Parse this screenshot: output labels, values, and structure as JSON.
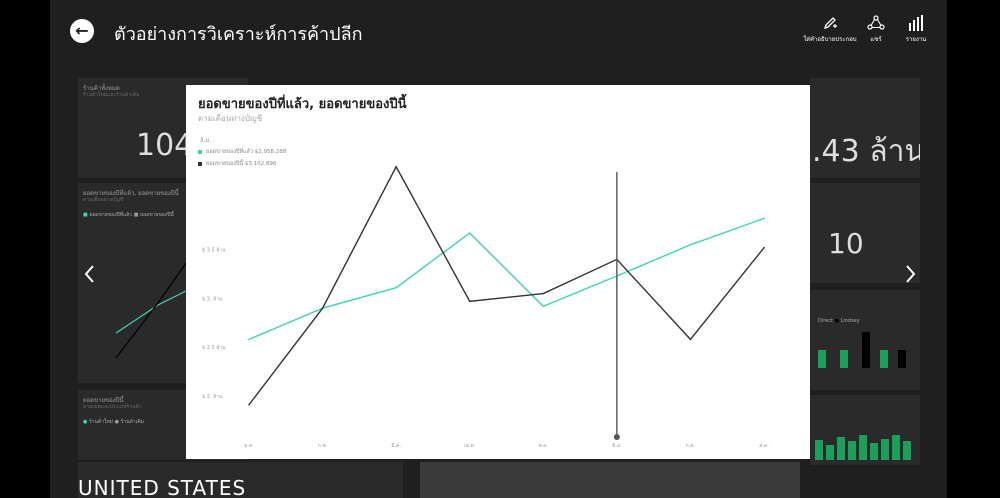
{
  "header": {
    "title": "ตัวอย่างการวิเคราะห์การค้าปลีก",
    "tools": [
      {
        "label": "ใส่คำอธิบายประกอบ",
        "icon": "annotate-pen-icon"
      },
      {
        "label": "แชร์",
        "icon": "share-icon"
      },
      {
        "label": "รายงาน",
        "icon": "report-bars-icon"
      }
    ]
  },
  "background": {
    "tile1_title": "ร้านค้าทั้งหมด",
    "tile1_sub": "ร้านค้าใหม่และร้านค้าเดิม",
    "tile1_value": "104",
    "tile2_title": "ยอดขายของปีที่แล้ว, ยอดขายของปีนี้",
    "tile2_sub": "ตามเดือนทางบัญชี",
    "tile2_legend": [
      "ยอดขายของปีที่แล้ว",
      "ยอดขายของปีนี้"
    ],
    "tile3_title": "ยอดขายของปีนี้",
    "tile3_sub": "ตามเขตและประเภทร้านค้า",
    "tile3_legend": [
      "ร้านค้าใหม่",
      "ร้านค้าเดิม"
    ],
    "right_value": ".43 ล้าน",
    "right_count": "10",
    "right_legend": [
      "Direct",
      "Lindsey"
    ],
    "map_label": "UNITED STATES"
  },
  "card": {
    "title": "ยอดขายของปีที่แล้ว, ยอดขายของปีนี้",
    "subtitle": "ตามเดือนทางบัญชี",
    "y_unit": "ล้.ม.",
    "legend": [
      {
        "label": "ยอดขายของปีที่แล้ว $2,958,288",
        "color": "#3dd6b5"
      },
      {
        "label": "ยอดขายของปีนี้ $3,102,896",
        "color": "#333333"
      }
    ]
  },
  "chart_data": {
    "type": "line",
    "title": "ยอดขายของปีที่แล้ว, ยอดขายของปีนี้",
    "subtitle": "ตามเดือนทางบัญชี",
    "categories": [
      "ม.ค.",
      "ก.พ.",
      "มี.ค.",
      "เม.ย.",
      "พ.ค.",
      "มิ.ย.",
      "ก.ค.",
      "ส.ค."
    ],
    "series": [
      {
        "name": "ยอดขายของปีที่แล้ว",
        "color": "#3dd6b5",
        "values": [
          2.58,
          2.9,
          3.11,
          3.67,
          2.92,
          3.23,
          3.55,
          3.82
        ]
      },
      {
        "name": "ยอดขายของปีนี้",
        "color": "#333333",
        "values": [
          1.91,
          2.9,
          4.35,
          2.97,
          3.05,
          3.4,
          2.58,
          3.52
        ]
      }
    ],
    "yticks": [
      "$ 2. ล้าน",
      "$ 2.5 ล้าน",
      "$ 3. ล้าน",
      "$ 3.5 ล้าน"
    ],
    "ytick_values": [
      2.0,
      2.5,
      3.0,
      3.5
    ],
    "ylim": [
      1.6,
      4.45
    ],
    "highlight_category": "มิ.ย.",
    "grid": false
  }
}
